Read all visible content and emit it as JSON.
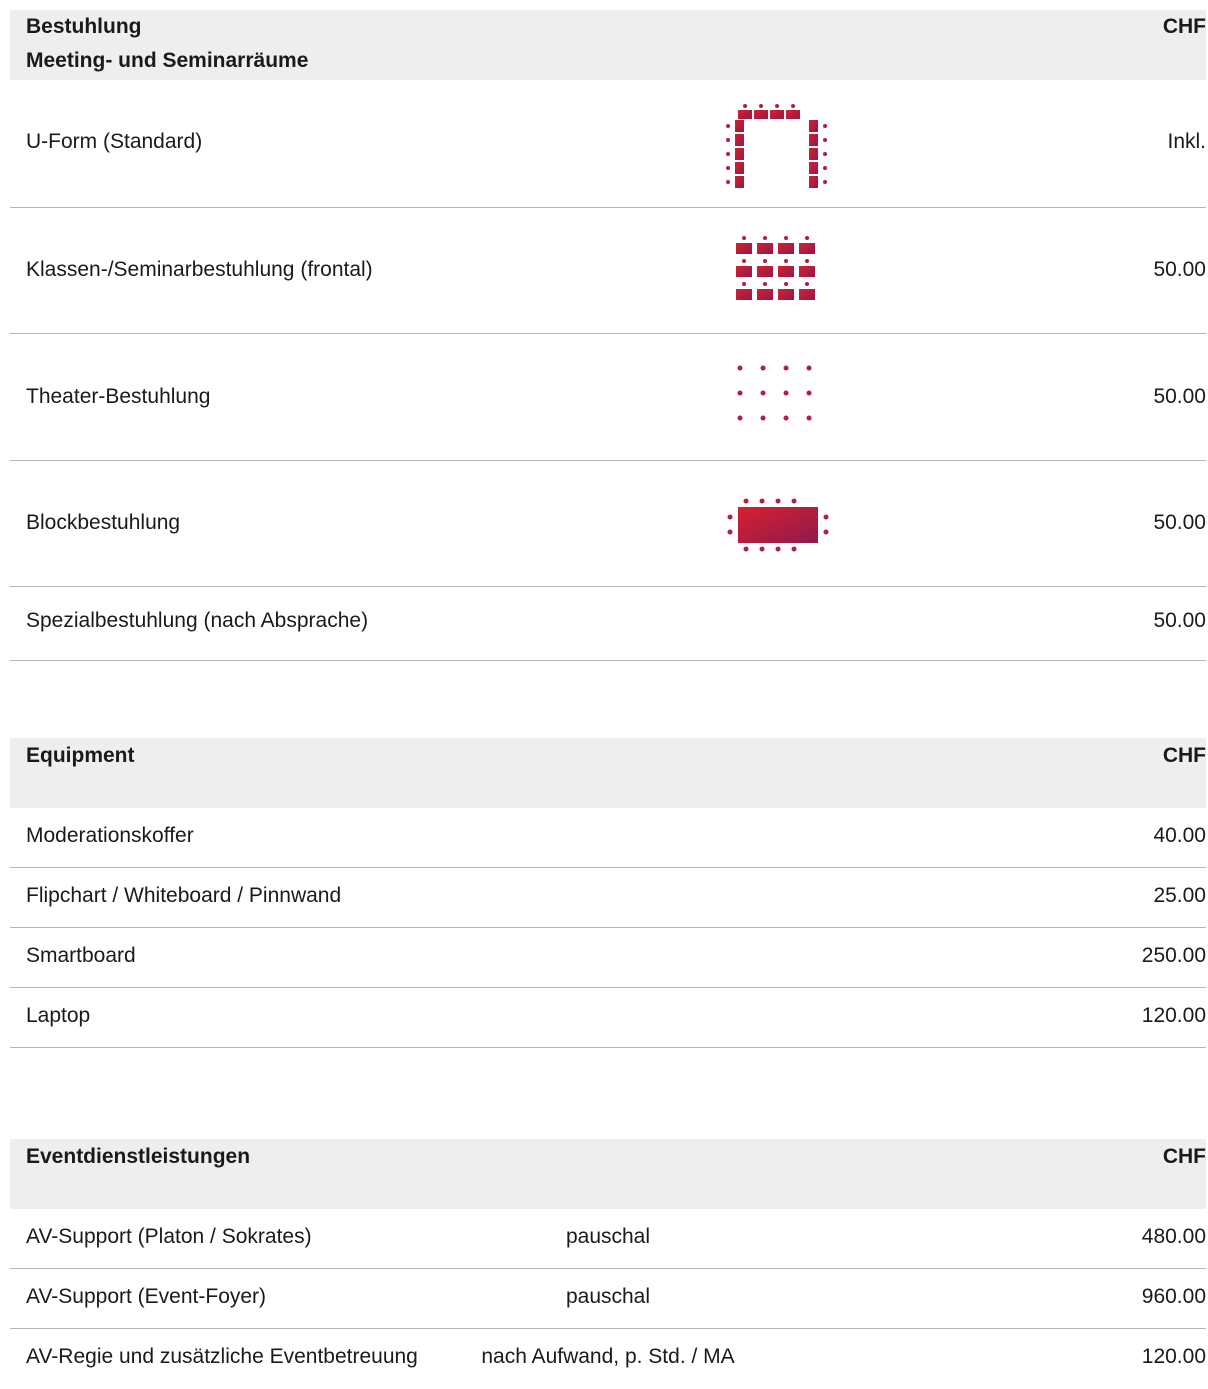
{
  "seating": {
    "title_line1": "Bestuhlung",
    "title_line2": "Meeting- und Seminarräume",
    "currency": "CHF",
    "rows": [
      {
        "label": "U-Form (Standard)",
        "icon": "u-shape-seating-icon",
        "price": "Inkl."
      },
      {
        "label": "Klassen-/Seminarbestuhlung (frontal)",
        "icon": "classroom-seating-icon",
        "price": "50.00"
      },
      {
        "label": "Theater-Bestuhlung",
        "icon": "theater-seating-icon",
        "price": "50.00"
      },
      {
        "label": "Blockbestuhlung",
        "icon": "block-seating-icon",
        "price": "50.00"
      },
      {
        "label": "Spezialbestuhlung (nach Absprache)",
        "price": "50.00"
      }
    ]
  },
  "equipment": {
    "title": "Equipment",
    "currency": "CHF",
    "rows": [
      {
        "label": "Moderationskoffer",
        "price": "40.00"
      },
      {
        "label": "Flipchart / Whiteboard / Pinnwand",
        "price": "25.00"
      },
      {
        "label": "Smartboard",
        "price": "250.00"
      },
      {
        "label": "Laptop",
        "price": "120.00"
      }
    ]
  },
  "services": {
    "title": "Eventdienstleistungen",
    "currency": "CHF",
    "rows": [
      {
        "label": "AV-Support (Platon / Sokrates)",
        "unit": "pauschal",
        "price": "480.00"
      },
      {
        "label": "AV-Support (Event-Foyer)",
        "unit": "pauschal",
        "price": "960.00"
      },
      {
        "label": "AV-Regie und zusätzliche Eventbetreuung",
        "unit": "nach Aufwand, p. Std. / MA",
        "price": "120.00"
      }
    ]
  },
  "colors": {
    "accent_start": "#d8202e",
    "accent_end": "#8e1a4e",
    "header_bg": "#eeeeee"
  }
}
